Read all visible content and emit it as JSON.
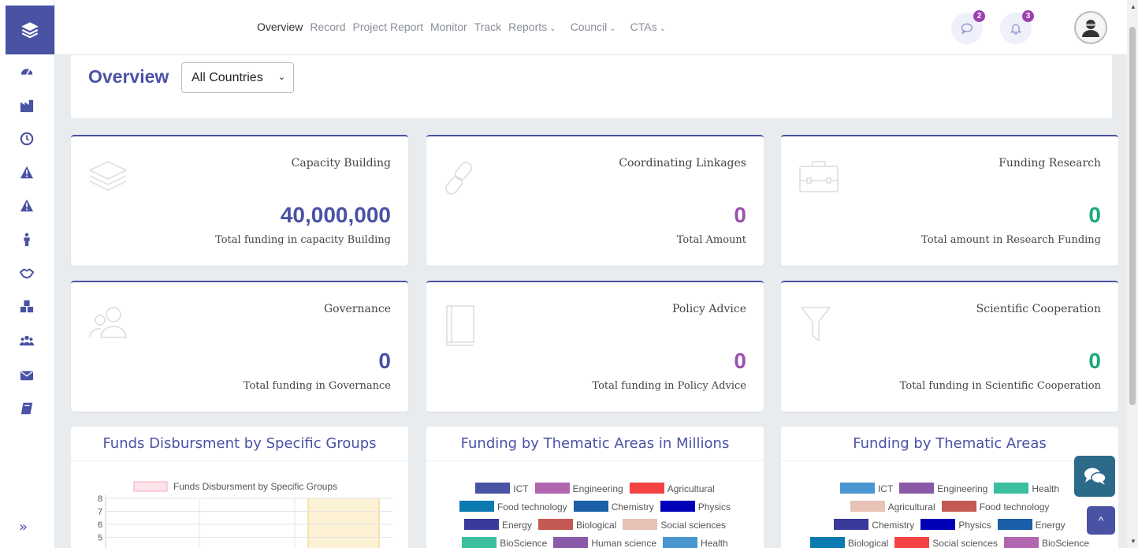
{
  "nav": {
    "items": [
      {
        "label": "Overview",
        "active": true
      },
      {
        "label": "Record",
        "active": false
      },
      {
        "label": "Project Report",
        "active": false
      },
      {
        "label": "Monitor",
        "active": false
      },
      {
        "label": "Track",
        "active": false
      },
      {
        "label": "Reports",
        "active": false,
        "dropdown": true
      },
      {
        "label": "Council",
        "active": false,
        "dropdown": true
      },
      {
        "label": "CTAs",
        "active": false,
        "dropdown": true
      }
    ],
    "messages_badge": "2",
    "notifications_badge": "3",
    "chevron": "⌄"
  },
  "sidebar": {
    "icons": [
      "dashboard-gauge-icon",
      "industry-icon",
      "clock-icon",
      "warning-icon",
      "alert-icon",
      "person-icon",
      "handshake-icon",
      "cubes-icon",
      "users-icon",
      "envelope-icon",
      "book-icon"
    ],
    "collapse_label": "»"
  },
  "overview": {
    "title": "Overview",
    "country_select": {
      "selected": "All Countries",
      "chevron": "⌄"
    }
  },
  "cards": [
    {
      "icon": "layers-icon",
      "title": "Capacity Building",
      "value": "40,000,000",
      "subtitle": "Total funding in capacity Building",
      "color": "#4a52a4"
    },
    {
      "icon": "link-icon",
      "title": "Coordinating Linkages",
      "value": "0",
      "subtitle": "Total Amount",
      "color": "#9c4fb0"
    },
    {
      "icon": "briefcase-icon",
      "title": "Funding Research",
      "value": "0",
      "subtitle": "Total amount in Research Funding",
      "color": "#1aa87a"
    },
    {
      "icon": "users-outline-icon",
      "title": "Governance",
      "value": "0",
      "subtitle": "Total funding in Governance",
      "color": "#4a52a4"
    },
    {
      "icon": "book-outline-icon",
      "title": "Policy Advice",
      "value": "0",
      "subtitle": "Total funding in Policy Advice",
      "color": "#9c4fb0"
    },
    {
      "icon": "funnel-icon",
      "title": "Scientific Cooperation",
      "value": "0",
      "subtitle": "Total funding in Scientific Cooperation",
      "color": "#1aa87a"
    }
  ],
  "chart_data": [
    {
      "type": "bar",
      "title": "Funds Disbursment by Specific Groups",
      "series": [
        {
          "name": "Funds Disbursment by Specific Groups",
          "color": "#f8c9d4"
        }
      ],
      "y_ticks": [
        "8",
        "7",
        "6",
        "5"
      ],
      "highlight_color": "#fdf1d6"
    },
    {
      "type": "pie",
      "title": "Funding by Thematic Areas in Millions",
      "legend": [
        [
          {
            "label": "ICT",
            "color": "#4a52a4"
          },
          {
            "label": "Engineering",
            "color": "#b366b0"
          },
          {
            "label": "Agricultural",
            "color": "#f44242"
          }
        ],
        [
          {
            "label": "Food technology",
            "color": "#0a7ab0"
          },
          {
            "label": "Chemistry",
            "color": "#1a5fa8"
          },
          {
            "label": "Physics",
            "color": "#0000b8"
          }
        ],
        [
          {
            "label": "Energy",
            "color": "#3a3a9c"
          },
          {
            "label": "Biological",
            "color": "#c45a52"
          },
          {
            "label": "Social sciences",
            "color": "#e8c2b6"
          }
        ],
        [
          {
            "label": "BioScience",
            "color": "#3bbf9f"
          },
          {
            "label": "Human science",
            "color": "#8a5aa8"
          },
          {
            "label": "Health",
            "color": "#4a96d0"
          }
        ]
      ]
    },
    {
      "type": "pie",
      "title": "Funding by Thematic Areas",
      "legend": [
        [
          {
            "label": "ICT",
            "color": "#4a96d0"
          },
          {
            "label": "Engineering",
            "color": "#8a5aa8"
          },
          {
            "label": "Health",
            "color": "#3bbf9f"
          }
        ],
        [
          {
            "label": "Agricultural",
            "color": "#e8c2b6"
          },
          {
            "label": "Food technology",
            "color": "#c45a52"
          }
        ],
        [
          {
            "label": "Chemistry",
            "color": "#3a3a9c"
          },
          {
            "label": "Physics",
            "color": "#0000b8"
          },
          {
            "label": "Energy",
            "color": "#1a5fa8"
          }
        ],
        [
          {
            "label": "Biological",
            "color": "#0a7ab0"
          },
          {
            "label": "Social sciences",
            "color": "#f44242"
          },
          {
            "label": "BioScience",
            "color": "#b366b0"
          }
        ]
      ]
    }
  ],
  "fab": {
    "chat_icon": "chat-bubbles-icon",
    "top_label": "^"
  }
}
